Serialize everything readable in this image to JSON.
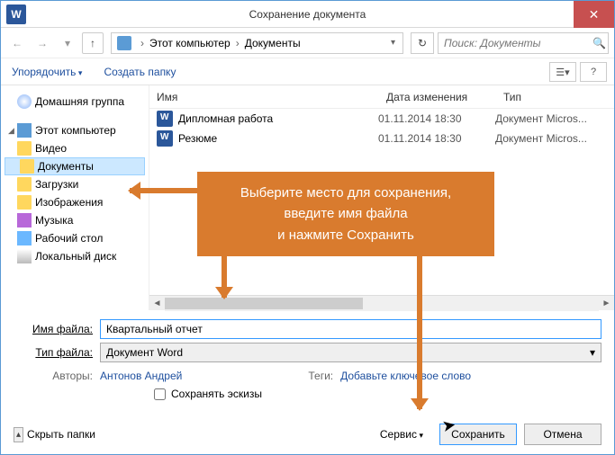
{
  "title": "Сохранение документа",
  "breadcrumb": {
    "root": "Этот компьютер",
    "folder": "Документы"
  },
  "search": {
    "placeholder": "Поиск: Документы"
  },
  "toolbar": {
    "organize": "Упорядочить",
    "newfolder": "Создать папку"
  },
  "sidebar": {
    "homegroup": "Домашняя группа",
    "pc": "Этот компьютер",
    "items": [
      "Видео",
      "Документы",
      "Загрузки",
      "Изображения",
      "Музыка",
      "Рабочий стол",
      "Локальный диск"
    ]
  },
  "columns": {
    "name": "Имя",
    "date": "Дата изменения",
    "type": "Тип"
  },
  "files": [
    {
      "name": "Дипломная работа",
      "date": "01.11.2014 18:30",
      "type": "Документ Micros..."
    },
    {
      "name": "Резюме",
      "date": "01.11.2014 18:30",
      "type": "Документ Micros..."
    }
  ],
  "labels": {
    "filename": "Имя файла:",
    "filetype": "Тип файла:",
    "authors": "Авторы:",
    "tags": "Теги:",
    "save_thumb": "Сохранять эскизы",
    "hide": "Скрыть папки",
    "tools": "Сервис",
    "save": "Сохранить",
    "cancel": "Отмена"
  },
  "values": {
    "filename": "Квартальный отчет",
    "filetype": "Документ Word",
    "author": "Антонов Андрей",
    "tags": "Добавьте ключевое слово"
  },
  "callout": {
    "l1": "Выберите место для сохранения,",
    "l2": "введите имя файла",
    "l3": "и нажмите Сохранить"
  }
}
